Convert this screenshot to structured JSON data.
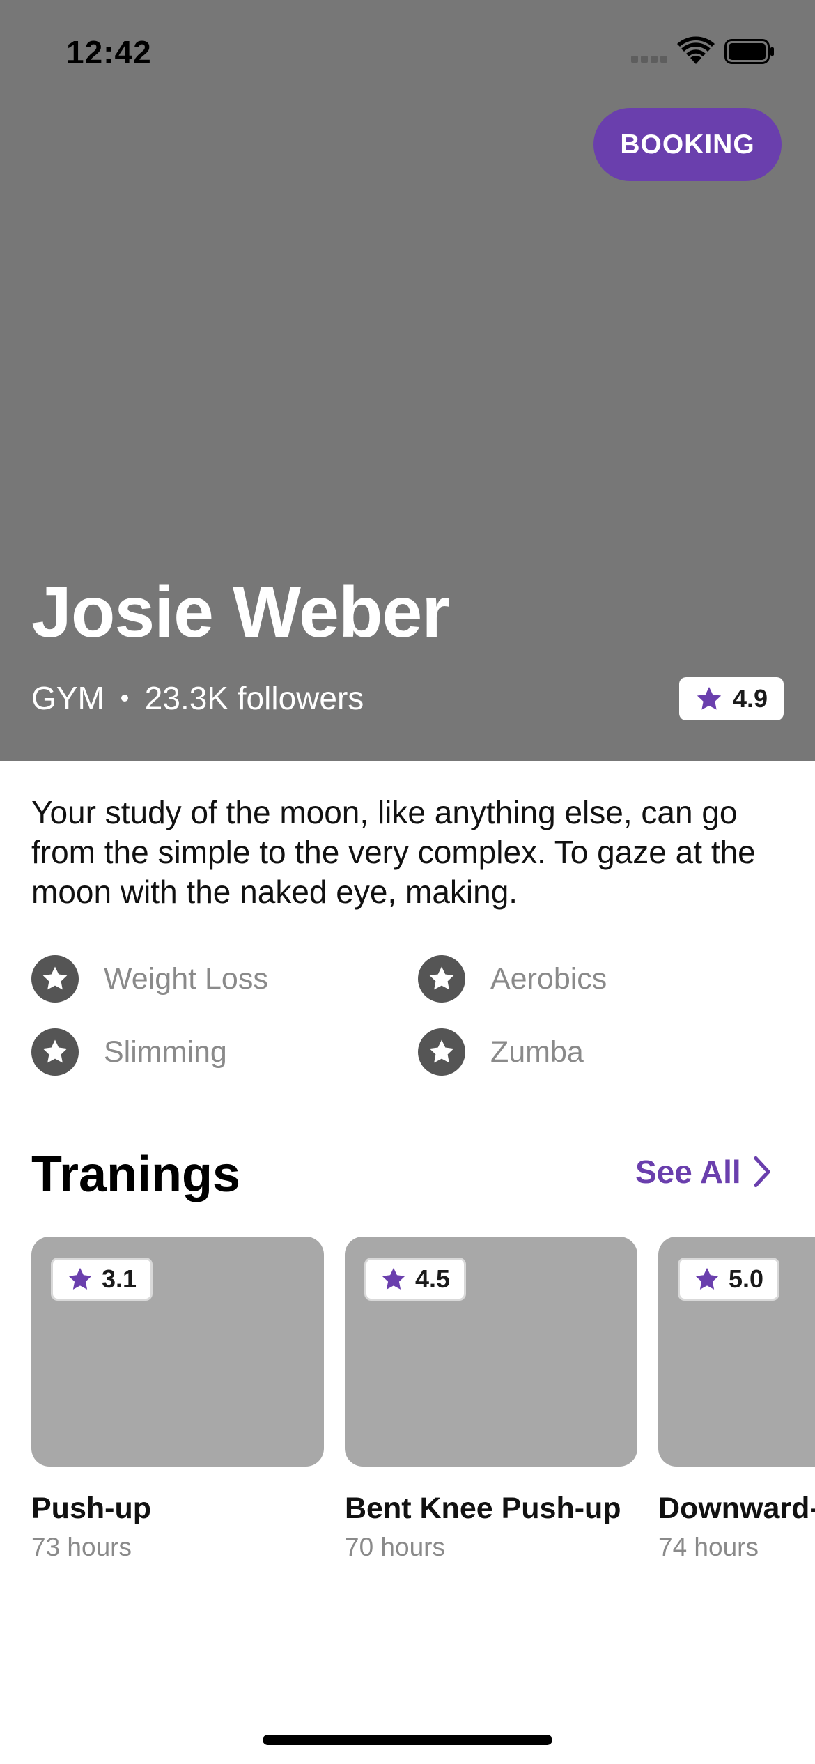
{
  "status_bar": {
    "time": "12:42"
  },
  "header": {
    "booking_label": "BOOKING",
    "name": "Josie Weber",
    "category": "GYM",
    "followers": "23.3K followers",
    "rating": "4.9"
  },
  "bio": "Your study of the moon, like anything else, can go from the simple to the very complex. To gaze at the moon with the naked eye, making.",
  "tags": [
    {
      "label": "Weight Loss",
      "icon": "star-icon"
    },
    {
      "label": "Aerobics",
      "icon": "star-icon"
    },
    {
      "label": "Slimming",
      "icon": "star-icon"
    },
    {
      "label": "Zumba",
      "icon": "star-icon"
    }
  ],
  "trainings": {
    "title": "Tranings",
    "see_all_label": "See All",
    "items": [
      {
        "title": "Push-up",
        "duration": "73 hours",
        "rating": "3.1"
      },
      {
        "title": "Bent Knee Push-up",
        "duration": "70 hours",
        "rating": "4.5"
      },
      {
        "title": "Downward-",
        "duration": "74 hours",
        "rating": "5.0"
      }
    ]
  },
  "colors": {
    "accent": "#6a3fad",
    "hero_bg": "#777777",
    "card_bg": "#a8a8a8",
    "tag_icon_bg": "#555555"
  }
}
